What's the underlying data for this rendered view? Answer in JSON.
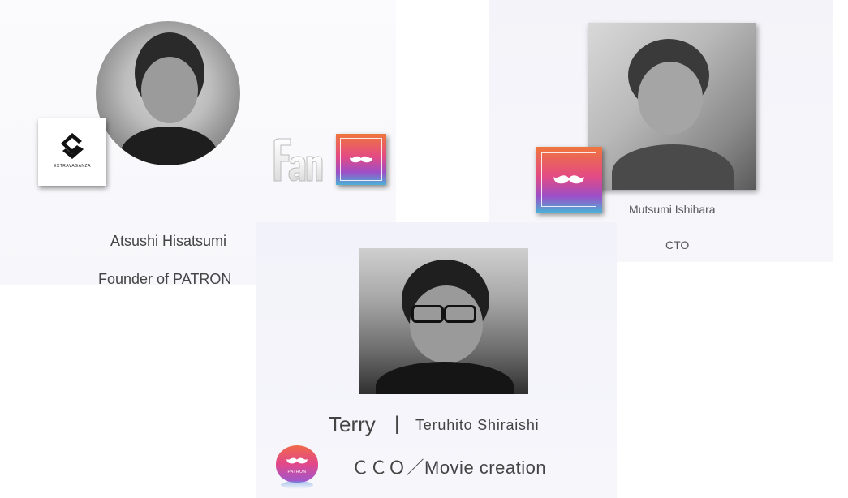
{
  "team": {
    "atsushi": {
      "name": "Atsushi Hisatsumi",
      "role": "Founder of  PATRON",
      "badge_logo_text": "EXTRAVAGANZA"
    },
    "mutsumi": {
      "name": "Mutsumi Ishihara",
      "role": "CTO"
    },
    "terry": {
      "nickname": "Terry",
      "separator": "|",
      "full_name": "Teruhito  Shiraishi",
      "role": "ＣＣＯ／Movie creation",
      "badge_logo_text": "PATRON"
    }
  },
  "colors": {
    "patron_gradient_top": "#f0753d",
    "patron_gradient_mid": "#e34b84",
    "patron_gradient_bottom": "#4bb0d6",
    "text": "#444444",
    "panel_background": "#f3f3f9"
  },
  "icons": {
    "extravaganza_logo": "extravaganza-logo-icon",
    "fan_logo": "fan-logo-icon",
    "patron_app_icon": "mustache-icon",
    "patron_round_logo": "patron-round-logo-icon"
  }
}
